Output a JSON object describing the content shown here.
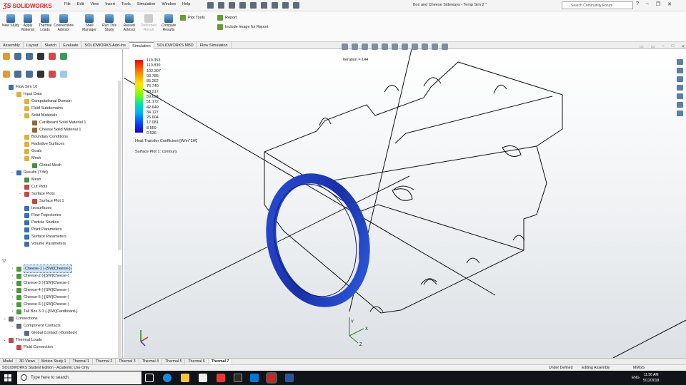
{
  "app": {
    "brand": "SOLIDWORKS",
    "title": "Box and Cheese Sideways - Temp Sim 2 *"
  },
  "menu": [
    "File",
    "Edit",
    "View",
    "Insert",
    "Tools",
    "Simulation",
    "Window",
    "Help"
  ],
  "search": {
    "placeholder": "Search Community Forum"
  },
  "ribbon": {
    "buttons": [
      {
        "label": "New Study",
        "disabled": false
      },
      {
        "label": "Apply Material",
        "disabled": false
      },
      {
        "label": "Thermal Loads",
        "disabled": false
      },
      {
        "label": "Connections Advisor",
        "disabled": false
      },
      {
        "label": "Shell Manager",
        "disabled": false
      },
      {
        "label": "Run This Study",
        "disabled": false
      },
      {
        "label": "Results Advisor",
        "disabled": false
      },
      {
        "label": "Deformed Result",
        "disabled": true
      },
      {
        "label": "Compare Results",
        "disabled": false
      }
    ],
    "plot_tools": "Plot Tools",
    "report": "Report",
    "include_image": "Include Image for Report"
  },
  "command_tabs": [
    "Assembly",
    "Layout",
    "Sketch",
    "Evaluate",
    "SOLIDWORKS Add-Ins",
    "Simulation",
    "SOLIDWORKS MBD",
    "Flow Simulation"
  ],
  "active_command_tab": "Simulation",
  "flow_tree": [
    {
      "label": "Flow Sim 10",
      "level": 0,
      "toggle": "",
      "icon": "#3b6fb5"
    },
    {
      "label": "Input Data",
      "level": 1,
      "toggle": "−",
      "icon": "#e0b040"
    },
    {
      "label": "Computational Domain",
      "level": 2,
      "toggle": "",
      "icon": "#e0b040"
    },
    {
      "label": "Fluid Subdomains",
      "level": 2,
      "toggle": "",
      "icon": "#e0b040"
    },
    {
      "label": "Solid Materials",
      "level": 2,
      "toggle": "−",
      "icon": "#e0b040"
    },
    {
      "label": "Cardboard Solid Material 1",
      "level": 3,
      "toggle": "",
      "icon": "#8c6a3a"
    },
    {
      "label": "Cheese Solid Material 1",
      "level": 3,
      "toggle": "",
      "icon": "#8c6a3a"
    },
    {
      "label": "Boundary Conditions",
      "level": 2,
      "toggle": "",
      "icon": "#e0b040"
    },
    {
      "label": "Radiative Surfaces",
      "level": 2,
      "toggle": "",
      "icon": "#e0b040"
    },
    {
      "label": "Goals",
      "level": 2,
      "toggle": "",
      "icon": "#e0b040"
    },
    {
      "label": "Mesh",
      "level": 2,
      "toggle": "−",
      "icon": "#e0b040"
    },
    {
      "label": "Global Mesh",
      "level": 3,
      "toggle": "",
      "icon": "#4a8a4a"
    },
    {
      "label": "Results (7.fld)",
      "level": 1,
      "toggle": "−",
      "icon": "#3b6fb5"
    },
    {
      "label": "Mesh",
      "level": 2,
      "toggle": "",
      "icon": "#4a8a4a"
    },
    {
      "label": "Cut Plots",
      "level": 2,
      "toggle": "",
      "icon": "#c04a4a"
    },
    {
      "label": "Surface Plots",
      "level": 2,
      "toggle": "−",
      "icon": "#c04a4a"
    },
    {
      "label": "Surface Plot 1",
      "level": 3,
      "toggle": "",
      "icon": "#c04a4a"
    },
    {
      "label": "Isosurfaces",
      "level": 2,
      "toggle": "",
      "icon": "#3b6fb5"
    },
    {
      "label": "Flow Trajectories",
      "level": 2,
      "toggle": "",
      "icon": "#3b6fb5"
    },
    {
      "label": "Particle Studies",
      "level": 2,
      "toggle": "",
      "icon": "#3b6fb5"
    },
    {
      "label": "Point Parameters",
      "level": 2,
      "toggle": "",
      "icon": "#3b6fb5"
    },
    {
      "label": "Surface Parameters",
      "level": 2,
      "toggle": "",
      "icon": "#3b6fb5"
    },
    {
      "label": "Volume Parameters",
      "level": 2,
      "toggle": "",
      "icon": "#3b6fb5"
    }
  ],
  "sim_tree": [
    {
      "label": "Cheese-1 (-[SW]Cheese-)",
      "level": 1,
      "toggle": "›",
      "icon": "#4a9a3a",
      "selected": true
    },
    {
      "label": "Cheese-2 (-[SW]Cheese-)",
      "level": 1,
      "toggle": "›",
      "icon": "#4a9a3a",
      "selected": false
    },
    {
      "label": "Cheese-3 (-[SW]Cheese-)",
      "level": 1,
      "toggle": "›",
      "icon": "#4a9a3a",
      "selected": false
    },
    {
      "label": "Cheese-4 (-[SW]Cheese-)",
      "level": 1,
      "toggle": "›",
      "icon": "#4a9a3a",
      "selected": false
    },
    {
      "label": "Cheese-5 (-[SW]Cheese-)",
      "level": 1,
      "toggle": "›",
      "icon": "#4a9a3a",
      "selected": false
    },
    {
      "label": "Cheese-6 (-[SW]Cheese-)",
      "level": 1,
      "toggle": "›",
      "icon": "#4a9a3a",
      "selected": false
    },
    {
      "label": "Tall Box 3-1 (-[SW]Cardboard-)",
      "level": 1,
      "toggle": "›",
      "icon": "#4a9a3a",
      "selected": false
    },
    {
      "label": "Connections",
      "level": 0,
      "toggle": "⌄",
      "icon": "#5a6b7d",
      "selected": false
    },
    {
      "label": "Component Contacts",
      "level": 1,
      "toggle": "⌄",
      "icon": "#5a6b7d",
      "selected": false
    },
    {
      "label": "Global Contact (-Bonded-)",
      "level": 2,
      "toggle": "",
      "icon": "#5a6b7d",
      "selected": false
    },
    {
      "label": "Thermal Loads",
      "level": 0,
      "toggle": "⌄",
      "icon": "#c04a4a",
      "selected": false
    },
    {
      "label": "Fluid Convection",
      "level": 1,
      "toggle": "",
      "icon": "#c04a4a",
      "selected": false
    }
  ],
  "legend": {
    "values": [
      "119.353",
      "110.830",
      "102.307",
      "93.785",
      "85.262",
      "76.740",
      "68.217",
      "59.694",
      "51.172",
      "42.649",
      "34.127",
      "25.604",
      "17.081",
      "8.559",
      "0.036"
    ],
    "title": "Heat Transfer Coefficient [W/m^2/K]",
    "plot_name": "Surface Plot 1: contours"
  },
  "iteration": "Iteration = 144",
  "bottom_tabs": [
    "Model",
    "3D Views",
    "Motion Study 1",
    "Thermal 1",
    "Thermal 2",
    "Thermal 3",
    "Thermal 4",
    "Thermal 5",
    "Thermal 6",
    "Thermal 7"
  ],
  "active_bottom_tab": "Thermal 7",
  "status": {
    "left": "SOLIDWORKS Student Edition - Academic Use Only",
    "state": "Under Defined",
    "mode": "Editing Assembly",
    "units": "MMGS"
  },
  "taskbar": {
    "search_placeholder": "Type here to search",
    "time": "11:56 AM",
    "date": "5/12/2018",
    "lang": "ENG"
  },
  "colors": {
    "accent": "#d9272e",
    "ring": "#1f3fb0",
    "select": "#cde4f7"
  }
}
